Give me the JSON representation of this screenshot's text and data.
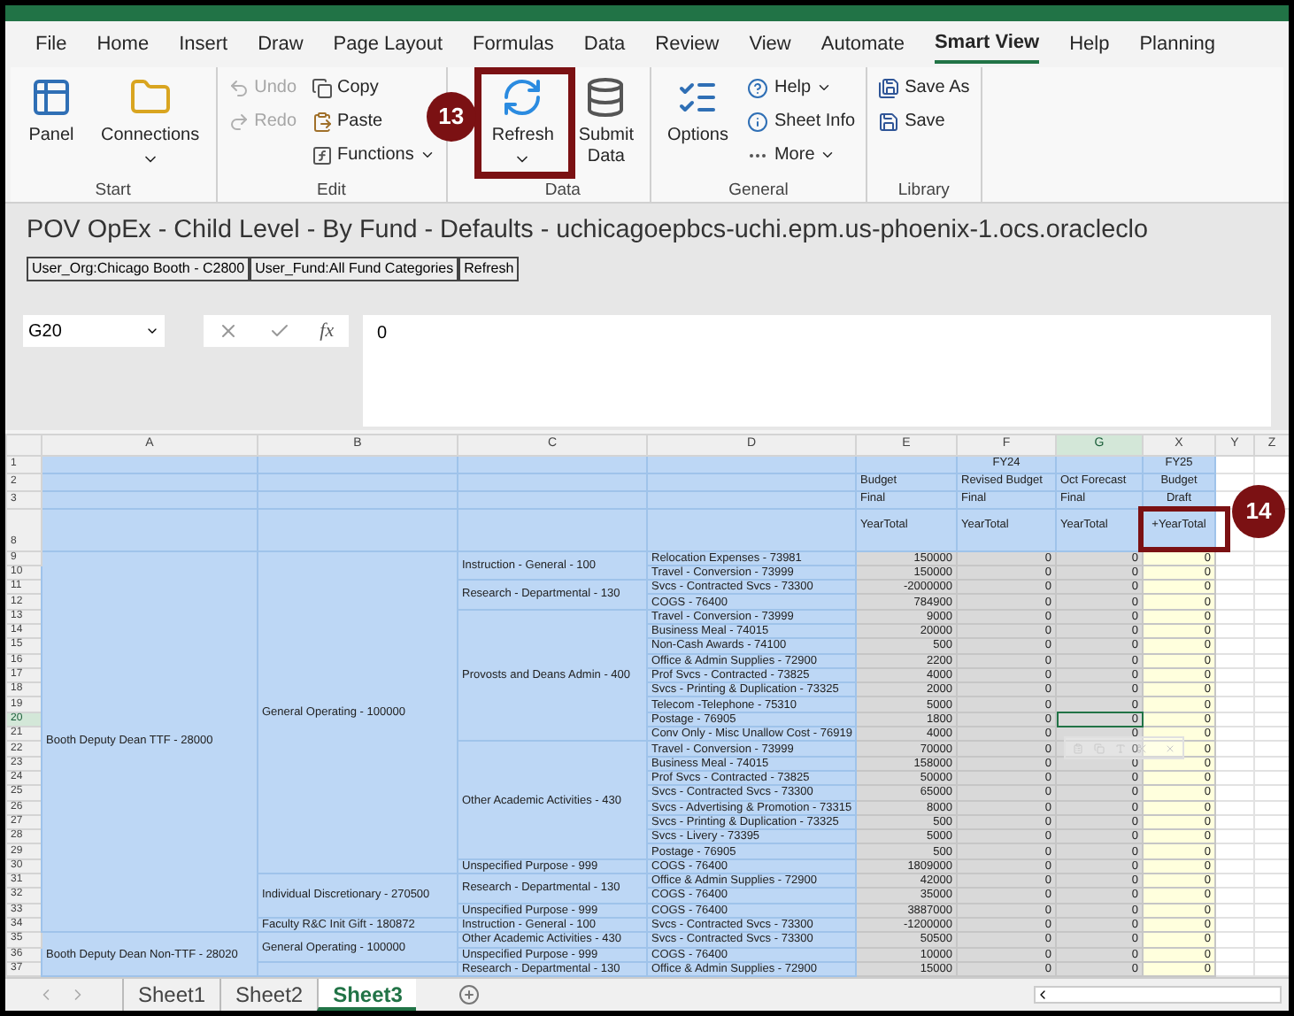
{
  "ribbon_tabs": [
    {
      "label": "File",
      "selected": false
    },
    {
      "label": "Home",
      "selected": false
    },
    {
      "label": "Insert",
      "selected": false
    },
    {
      "label": "Draw",
      "selected": false
    },
    {
      "label": "Page Layout",
      "selected": false
    },
    {
      "label": "Formulas",
      "selected": false
    },
    {
      "label": "Data",
      "selected": false
    },
    {
      "label": "Review",
      "selected": false
    },
    {
      "label": "View",
      "selected": false
    },
    {
      "label": "Automate",
      "selected": false
    },
    {
      "label": "Smart View",
      "selected": true
    },
    {
      "label": "Help",
      "selected": false
    },
    {
      "label": "Planning",
      "selected": false
    }
  ],
  "ribbon_groups": [
    {
      "label": "Start",
      "columns": [
        [
          {
            "kind": "large",
            "label": "Panel",
            "dropdown": false,
            "disabled": false
          }
        ],
        [
          {
            "kind": "large",
            "label": "Connections",
            "dropdown": true,
            "disabled": false
          }
        ]
      ]
    },
    {
      "label": "Edit",
      "columns": [
        [
          {
            "kind": "small",
            "label": "Undo",
            "dropdown": false,
            "disabled": true
          },
          {
            "kind": "small",
            "label": "Redo",
            "dropdown": false,
            "disabled": true
          }
        ],
        [
          {
            "kind": "small",
            "label": "Copy",
            "dropdown": false,
            "disabled": false
          },
          {
            "kind": "small",
            "label": "Paste",
            "dropdown": false,
            "disabled": false
          },
          {
            "kind": "small",
            "label": "Functions",
            "dropdown": true,
            "disabled": false
          }
        ]
      ]
    },
    {
      "label": "Data",
      "columns": [
        [
          {
            "kind": "large",
            "label": "Refresh",
            "dropdown": true,
            "disabled": false
          }
        ],
        [
          {
            "kind": "large",
            "label": "Submit Data",
            "dropdown": false,
            "disabled": false
          }
        ]
      ]
    },
    {
      "label": "General",
      "columns": [
        [
          {
            "kind": "large",
            "label": "Options",
            "dropdown": false,
            "disabled": false
          }
        ],
        [
          {
            "kind": "small",
            "label": "Help",
            "dropdown": true,
            "disabled": false
          },
          {
            "kind": "small",
            "label": "Sheet Info",
            "dropdown": false,
            "disabled": false
          },
          {
            "kind": "small",
            "label": "More",
            "dropdown": true,
            "disabled": false
          }
        ]
      ]
    },
    {
      "label": "Library",
      "columns": [
        [
          {
            "kind": "small",
            "label": "Save As",
            "dropdown": false,
            "disabled": false
          },
          {
            "kind": "small",
            "label": "Save",
            "dropdown": false,
            "disabled": false
          }
        ]
      ]
    }
  ],
  "callouts": [
    {
      "number": "13"
    },
    {
      "number": "14"
    }
  ],
  "sheet_title": "POV OpEx - Child Level - By Fund - Defaults - uchicagoepbcs-uchi.epm.us-phoenix-1.ocs.oracleclo",
  "pov_buttons": [
    "User_Org:Chicago Booth - C2800",
    "User_Fund:All Fund Categories",
    "Refresh"
  ],
  "formula_bar": {
    "name_box": "G20",
    "function_label": "fx",
    "value": "0"
  },
  "row_label_columns": [
    "A",
    "B",
    "C",
    "D"
  ],
  "data_columns": [
    {
      "letter": "E",
      "scenario": "Budget",
      "version": "Final",
      "period": "YearTotal"
    },
    {
      "letter": "F",
      "year": "FY24",
      "scenario": "Revised Budget",
      "version": "Final",
      "period": "YearTotal"
    },
    {
      "letter": "G",
      "scenario": "Oct Forecast",
      "version": "Final",
      "period": "YearTotal"
    },
    {
      "letter": "X",
      "year": "FY25",
      "scenario": "Budget",
      "version": "Draft",
      "period": "+YearTotal"
    }
  ],
  "trailing_columns": [
    "Y",
    "Z"
  ],
  "header_row_numbers": [
    "1",
    "2",
    "3",
    "8"
  ],
  "entities": [
    {
      "name": "Booth Deputy Dean TTF - 28000",
      "funds": [
        {
          "name": "General Operating - 100000",
          "purposes": [
            {
              "name": "Instruction - General - 100",
              "rows": [
                {
                  "num": "9",
                  "account": "Relocation Expenses - 73981",
                  "values": [
                    "150000",
                    "0",
                    "0",
                    "0"
                  ],
                  "selected": [
                    false,
                    false,
                    false,
                    false
                  ]
                },
                {
                  "num": "10",
                  "account": "Travel - Conversion - 73999",
                  "values": [
                    "150000",
                    "0",
                    "0",
                    "0"
                  ],
                  "selected": [
                    false,
                    false,
                    false,
                    false
                  ]
                }
              ]
            },
            {
              "name": "Research - Departmental - 130",
              "rows": [
                {
                  "num": "11",
                  "account": "Svcs - Contracted Svcs - 73300",
                  "values": [
                    "-2000000",
                    "0",
                    "0",
                    "0"
                  ],
                  "selected": [
                    false,
                    false,
                    false,
                    false
                  ]
                },
                {
                  "num": "12",
                  "account": "COGS - 76400",
                  "values": [
                    "784900",
                    "0",
                    "0",
                    "0"
                  ],
                  "selected": [
                    false,
                    false,
                    false,
                    false
                  ]
                }
              ]
            },
            {
              "name": "Provosts and Deans Admin - 400",
              "rows": [
                {
                  "num": "13",
                  "account": "Travel - Conversion - 73999",
                  "values": [
                    "9000",
                    "0",
                    "0",
                    "0"
                  ],
                  "selected": [
                    false,
                    false,
                    false,
                    false
                  ]
                },
                {
                  "num": "14",
                  "account": "Business Meal - 74015",
                  "values": [
                    "20000",
                    "0",
                    "0",
                    "0"
                  ],
                  "selected": [
                    false,
                    false,
                    false,
                    false
                  ]
                },
                {
                  "num": "15",
                  "account": "Non-Cash Awards - 74100",
                  "values": [
                    "500",
                    "0",
                    "0",
                    "0"
                  ],
                  "selected": [
                    false,
                    false,
                    false,
                    false
                  ]
                },
                {
                  "num": "16",
                  "account": "Office & Admin Supplies - 72900",
                  "values": [
                    "2200",
                    "0",
                    "0",
                    "0"
                  ],
                  "selected": [
                    false,
                    false,
                    false,
                    false
                  ]
                },
                {
                  "num": "17",
                  "account": "Prof Svcs - Contracted - 73825",
                  "values": [
                    "4000",
                    "0",
                    "0",
                    "0"
                  ],
                  "selected": [
                    false,
                    false,
                    false,
                    false
                  ]
                },
                {
                  "num": "18",
                  "account": "Svcs - Printing & Duplication - 73325",
                  "values": [
                    "2000",
                    "0",
                    "0",
                    "0"
                  ],
                  "selected": [
                    false,
                    false,
                    false,
                    false
                  ]
                },
                {
                  "num": "19",
                  "account": "Telecom -Telephone - 75310",
                  "values": [
                    "5000",
                    "0",
                    "0",
                    "0"
                  ],
                  "selected": [
                    false,
                    false,
                    false,
                    false
                  ]
                },
                {
                  "num": "20",
                  "account": "Postage - 76905",
                  "values": [
                    "1800",
                    "0",
                    "0",
                    "0"
                  ],
                  "selected": [
                    false,
                    false,
                    true,
                    false
                  ]
                },
                {
                  "num": "21",
                  "account": "Conv Only - Misc Unallow Cost - 76919",
                  "values": [
                    "4000",
                    "0",
                    "0",
                    "0"
                  ],
                  "selected": [
                    false,
                    false,
                    false,
                    false
                  ]
                }
              ]
            },
            {
              "name": "Other Academic Activities - 430",
              "rows": [
                {
                  "num": "22",
                  "account": "Travel - Conversion - 73999",
                  "values": [
                    "70000",
                    "0",
                    "0",
                    "0"
                  ],
                  "selected": [
                    false,
                    false,
                    false,
                    false
                  ]
                },
                {
                  "num": "23",
                  "account": "Business Meal - 74015",
                  "values": [
                    "158000",
                    "0",
                    "0",
                    "0"
                  ],
                  "selected": [
                    false,
                    false,
                    false,
                    false
                  ]
                },
                {
                  "num": "24",
                  "account": "Prof Svcs - Contracted - 73825",
                  "values": [
                    "50000",
                    "0",
                    "0",
                    "0"
                  ],
                  "selected": [
                    false,
                    false,
                    false,
                    false
                  ]
                },
                {
                  "num": "25",
                  "account": "Svcs - Contracted Svcs - 73300",
                  "values": [
                    "65000",
                    "0",
                    "0",
                    "0"
                  ],
                  "selected": [
                    false,
                    false,
                    false,
                    false
                  ]
                },
                {
                  "num": "26",
                  "account": "Svcs - Advertising & Promotion - 73315",
                  "values": [
                    "8000",
                    "0",
                    "0",
                    "0"
                  ],
                  "selected": [
                    false,
                    false,
                    false,
                    false
                  ]
                },
                {
                  "num": "27",
                  "account": "Svcs - Printing & Duplication - 73325",
                  "values": [
                    "500",
                    "0",
                    "0",
                    "0"
                  ],
                  "selected": [
                    false,
                    false,
                    false,
                    false
                  ]
                },
                {
                  "num": "28",
                  "account": "Svcs - Livery - 73395",
                  "values": [
                    "5000",
                    "0",
                    "0",
                    "0"
                  ],
                  "selected": [
                    false,
                    false,
                    false,
                    false
                  ]
                },
                {
                  "num": "29",
                  "account": "Postage - 76905",
                  "values": [
                    "500",
                    "0",
                    "0",
                    "0"
                  ],
                  "selected": [
                    false,
                    false,
                    false,
                    false
                  ]
                }
              ]
            },
            {
              "name": "Unspecified Purpose - 999",
              "rows": [
                {
                  "num": "30",
                  "account": "COGS - 76400",
                  "values": [
                    "1809000",
                    "0",
                    "0",
                    "0"
                  ],
                  "selected": [
                    false,
                    false,
                    false,
                    false
                  ]
                }
              ]
            }
          ]
        },
        {
          "name": "Individual Discretionary - 270500",
          "purposes": [
            {
              "name": "Research - Departmental - 130",
              "rows": [
                {
                  "num": "31",
                  "account": "Office & Admin Supplies - 72900",
                  "values": [
                    "42000",
                    "0",
                    "0",
                    "0"
                  ],
                  "selected": [
                    false,
                    false,
                    false,
                    false
                  ]
                },
                {
                  "num": "32",
                  "account": "COGS - 76400",
                  "values": [
                    "35000",
                    "0",
                    "0",
                    "0"
                  ],
                  "selected": [
                    false,
                    false,
                    false,
                    false
                  ]
                }
              ]
            },
            {
              "name": "Unspecified Purpose - 999",
              "rows": [
                {
                  "num": "33",
                  "account": "COGS - 76400",
                  "values": [
                    "3887000",
                    "0",
                    "0",
                    "0"
                  ],
                  "selected": [
                    false,
                    false,
                    false,
                    false
                  ]
                }
              ]
            }
          ]
        },
        {
          "name": "Faculty R&C Init Gift - 180872",
          "purposes": [
            {
              "name": "Instruction - General - 100",
              "rows": [
                {
                  "num": "34",
                  "account": "Svcs - Contracted Svcs - 73300",
                  "values": [
                    "-1200000",
                    "0",
                    "0",
                    "0"
                  ],
                  "selected": [
                    false,
                    false,
                    false,
                    false
                  ]
                }
              ]
            }
          ]
        }
      ]
    },
    {
      "name": "Booth Deputy Dean Non-TTF - 28020",
      "funds": [
        {
          "name": "General Operating - 100000",
          "purposes": [
            {
              "name": "Other Academic Activities - 430",
              "rows": [
                {
                  "num": "35",
                  "account": "Svcs - Contracted Svcs - 73300",
                  "values": [
                    "50500",
                    "0",
                    "0",
                    "0"
                  ],
                  "selected": [
                    false,
                    false,
                    false,
                    false
                  ]
                }
              ]
            },
            {
              "name": "Unspecified Purpose - 999",
              "rows": [
                {
                  "num": "36",
                  "account": "COGS - 76400",
                  "values": [
                    "10000",
                    "0",
                    "0",
                    "0"
                  ],
                  "selected": [
                    false,
                    false,
                    false,
                    false
                  ]
                }
              ]
            }
          ]
        },
        {
          "purposes": [
            {
              "name": "Research - Departmental - 130",
              "rows": [
                {
                  "num": "37",
                  "account": "Office & Admin Supplies - 72900",
                  "values": [
                    "15000",
                    "0",
                    "0",
                    "0"
                  ],
                  "selected": [
                    false,
                    false,
                    false,
                    false
                  ]
                }
              ]
            }
          ]
        }
      ]
    }
  ],
  "sheet_tabs": [
    {
      "label": "Sheet1",
      "selected": false
    },
    {
      "label": "Sheet2",
      "selected": false
    },
    {
      "label": "Sheet3",
      "selected": true
    }
  ]
}
